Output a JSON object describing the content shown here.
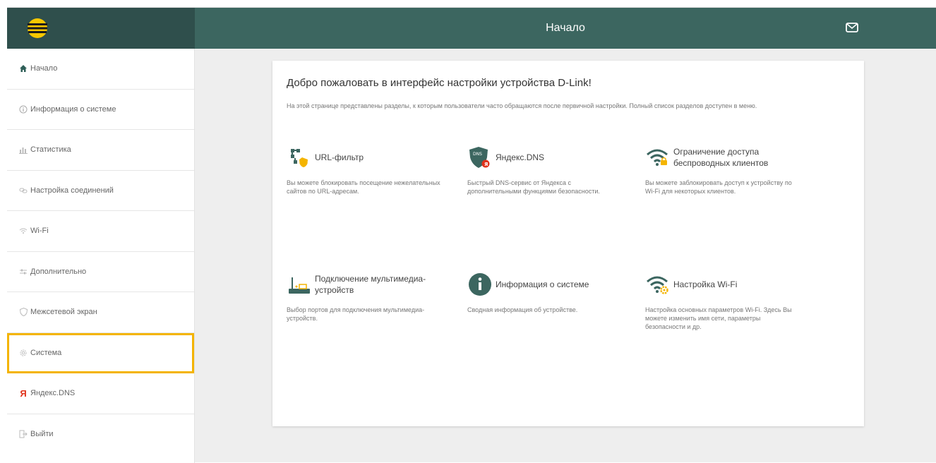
{
  "header": {
    "title": "Начало",
    "accent": "#3c6660",
    "logo_bg": "#2f4f4c"
  },
  "sidebar": {
    "items": [
      {
        "icon": "home-icon",
        "label": "Начало"
      },
      {
        "icon": "info-icon",
        "label": "Информация о системе"
      },
      {
        "icon": "chart-icon",
        "label": "Статистика"
      },
      {
        "icon": "link-icon",
        "label": "Настройка соединений"
      },
      {
        "icon": "wifi-icon",
        "label": "Wi-Fi"
      },
      {
        "icon": "sliders-icon",
        "label": "Дополнительно"
      },
      {
        "icon": "shield-icon",
        "label": "Межсетевой экран"
      },
      {
        "icon": "gear-icon",
        "label": "Система"
      },
      {
        "icon": "yandex-icon",
        "label": "Яндекс.DNS"
      },
      {
        "icon": "logout-icon",
        "label": "Выйти"
      }
    ],
    "highlight_color": "#f4b400"
  },
  "main": {
    "welcome": "Добро пожаловать в интерфейс настройки устройства D-Link!",
    "intro": "На этой странице представлены разделы, к которым пользователи часто обращаются после первичной настройки. Полный список разделов доступен в меню.",
    "tiles": [
      {
        "icon": "url-filter-icon",
        "title": "URL-фильтр",
        "desc": "Вы можете блокировать посещение нежелательных сайтов по URL-адресам."
      },
      {
        "icon": "dns-shield-icon",
        "title": "Яндекс.DNS",
        "desc": "Быстрый DNS-сервис от Яндекса с дополнительными функциями безопасности."
      },
      {
        "icon": "wifi-lock-icon",
        "title": "Ограничение доступа беспроводных клиентов",
        "desc": "Вы можете заблокировать доступ к устройству по Wi-Fi для некоторых клиентов."
      },
      {
        "icon": "router-icon",
        "title": "Подключение мультимедиа-устройств",
        "desc": "Выбор портов для подключения мультимедиа-устройств."
      },
      {
        "icon": "info-circle-icon",
        "title": "Информация о системе",
        "desc": "Сводная информация об устройстве."
      },
      {
        "icon": "wifi-gear-icon",
        "title": "Настройка Wi-Fi",
        "desc": "Настройка основных параметров Wi-Fi. Здесь Вы можете изменить имя сети, параметры безопасности и др."
      }
    ]
  }
}
